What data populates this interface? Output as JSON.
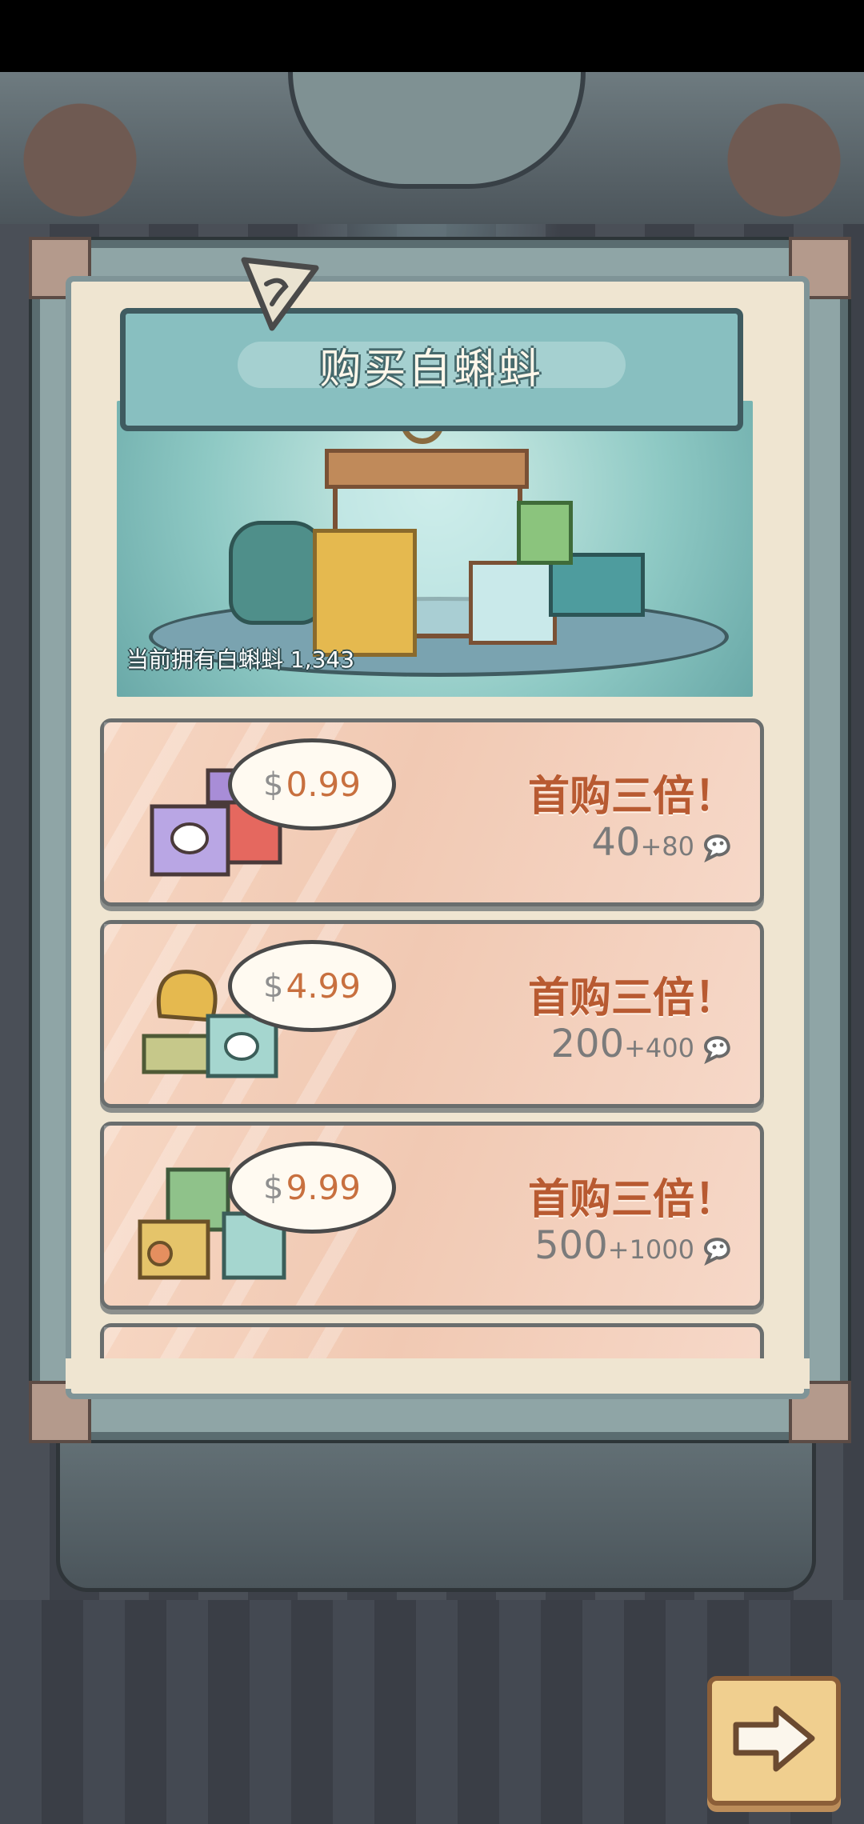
{
  "dialog": {
    "title": "购买白蝌蚪",
    "owned_label": "当前拥有白蝌蚪  1,343"
  },
  "packages": [
    {
      "currency": "$",
      "price": "0.99",
      "promo": "首购三倍！",
      "base": "40",
      "bonus": "+80",
      "icon": "tadpole-icon"
    },
    {
      "currency": "$",
      "price": "4.99",
      "promo": "首购三倍！",
      "base": "200",
      "bonus": "+400",
      "icon": "tadpole-icon"
    },
    {
      "currency": "$",
      "price": "9.99",
      "promo": "首购三倍！",
      "base": "500",
      "bonus": "+1000",
      "icon": "tadpole-icon"
    }
  ],
  "colors": {
    "accent_text": "#b85a31",
    "price_text": "#c8703f",
    "panel_teal": "#88bfc0"
  }
}
